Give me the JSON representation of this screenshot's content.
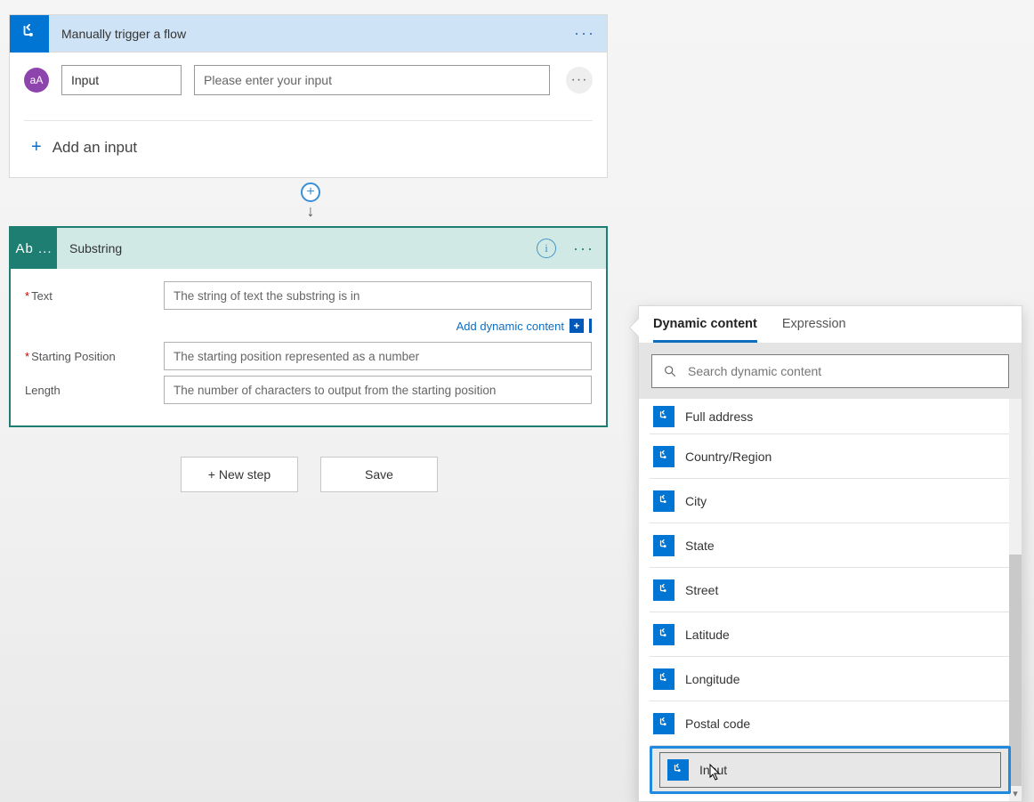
{
  "trigger": {
    "title": "Manually trigger a flow",
    "input_name": "Input",
    "input_placeholder": "Please enter your input",
    "add_input_label": "Add an input",
    "badge_text": "aA"
  },
  "action": {
    "icon_text": "Ab ...",
    "title": "Substring",
    "fields": [
      {
        "label": "Text",
        "required": true,
        "placeholder": "The string of text the substring is in"
      },
      {
        "label": "Starting Position",
        "required": true,
        "placeholder": "The starting position represented as a number"
      },
      {
        "label": "Length",
        "required": false,
        "placeholder": "The number of characters to output from the starting position"
      }
    ],
    "dynamic_link": "Add dynamic content"
  },
  "buttons": {
    "new_step": "+ New step",
    "save": "Save"
  },
  "panel": {
    "tabs": {
      "dynamic": "Dynamic content",
      "expression": "Expression"
    },
    "search_placeholder": "Search dynamic content",
    "items": [
      {
        "label": "Full address"
      },
      {
        "label": "Country/Region"
      },
      {
        "label": "City"
      },
      {
        "label": "State"
      },
      {
        "label": "Street"
      },
      {
        "label": "Latitude"
      },
      {
        "label": "Longitude"
      },
      {
        "label": "Postal code"
      },
      {
        "label": "Input",
        "selected": true
      }
    ]
  }
}
